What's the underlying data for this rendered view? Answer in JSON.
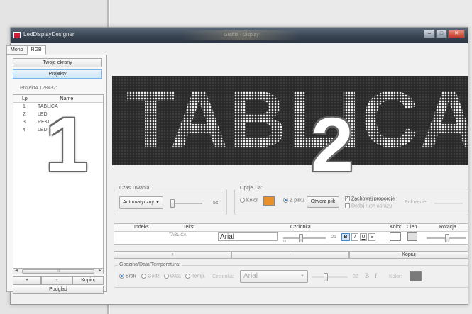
{
  "window": {
    "title": "LedDisplayDesigner",
    "ghost_title": "Graffiti · Display",
    "buttons": {
      "min": "–",
      "max": "□",
      "close": "✕"
    }
  },
  "left": {
    "tabs": [
      "Mono",
      "RGB"
    ],
    "buttons": {
      "screens": "Twoje ekrany",
      "projects": "Projekty"
    },
    "project_label": "Projekt4 128x32:",
    "list_header": {
      "lp": "Lp",
      "name": "Name"
    },
    "rows": [
      {
        "lp": "1",
        "name": "TABLICA"
      },
      {
        "lp": "2",
        "name": "LED"
      },
      {
        "lp": "3",
        "name": "REKL"
      },
      {
        "lp": "4",
        "name": "LED"
      }
    ],
    "scroll_label": "III",
    "bottom": {
      "add": "+",
      "remove": "-",
      "copy": "Kopiuj",
      "preview": "Podglad"
    }
  },
  "overlay": {
    "one": "1",
    "two": "2"
  },
  "led": {
    "text": "TABLICA"
  },
  "duration": {
    "label": "Czas Trwania:",
    "mode": "Automatyczny",
    "value": "5s"
  },
  "background": {
    "label": "Opcje Tla:",
    "color_option": "Kolor",
    "file_option": "Z pliku",
    "open_button": "Otworz plik",
    "keep_ratio": "Zachowaj proporcje",
    "add_motion": "Dodaj ruch obrazu",
    "position_label": "Polozenie:",
    "color": "#e8902c"
  },
  "grid": {
    "headers": {
      "index": "Indeks",
      "text": "Tekst",
      "font": "Czcionka",
      "color": "Kolor",
      "shadow": "Cien",
      "rotation": "Rotacja"
    },
    "row": {
      "text": "TABLICA",
      "font": "Arial",
      "size": "21"
    },
    "scroll": "III"
  },
  "row_buttons": {
    "add": "+",
    "remove": "-",
    "copy": "Kopiuj"
  },
  "clock": {
    "label": "Godzina/Data/Temperatura:",
    "options": [
      "Brak",
      "Godz",
      "Data",
      "Temp."
    ],
    "font_label": "Czcionka:",
    "font": "Arial",
    "size": "32",
    "bold": "B",
    "italic": "I",
    "color_label": "Kolor:",
    "color": "#7a7a7a"
  }
}
